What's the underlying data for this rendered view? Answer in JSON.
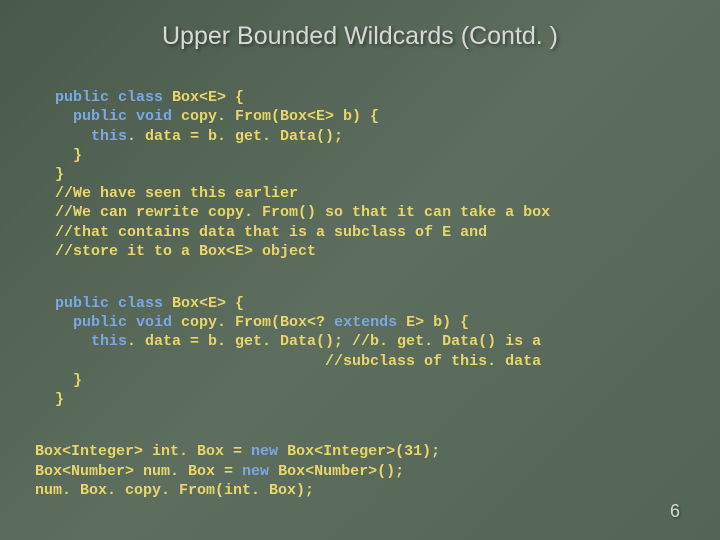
{
  "title": "Upper Bounded Wildcards (Contd. )",
  "page_number": "6",
  "block1": {
    "l1_kw": "public class ",
    "l1_tx": "Box<E> {",
    "l2_kw1": "  public void ",
    "l2_tx": "copy. From(Box<E> b) {",
    "l3_kw": "    this",
    "l3_tx": ". data = b. get. Data();",
    "l4": "  }",
    "l5": "}",
    "l6": "//We have seen this earlier",
    "l7": "//We can rewrite copy. From() so that it can take a box",
    "l8": "//that contains data that is a subclass of E and",
    "l9": "//store it to a Box<E> object"
  },
  "block2": {
    "l1_kw": "public class ",
    "l1_tx": "Box<E> {",
    "l2_kw1": "  public void ",
    "l2_tx1": "copy. From(Box<? ",
    "l2_kw2": "extends ",
    "l2_tx2": "E> b) {",
    "l3_kw": "    this",
    "l3_tx": ". data = b. get. Data(); //b. get. Data() is a",
    "l4": "                              //subclass of this. data",
    "l5": "  }",
    "l6": "}"
  },
  "block3": {
    "l1_tx1": "Box<Integer> int. Box = ",
    "l1_kw": "new ",
    "l1_tx2": "Box<Integer>(31);",
    "l2_tx1": "Box<Number> num. Box = ",
    "l2_kw": "new ",
    "l2_tx2": "Box<Number>();",
    "l3": "num. Box. copy. From(int. Box);"
  }
}
